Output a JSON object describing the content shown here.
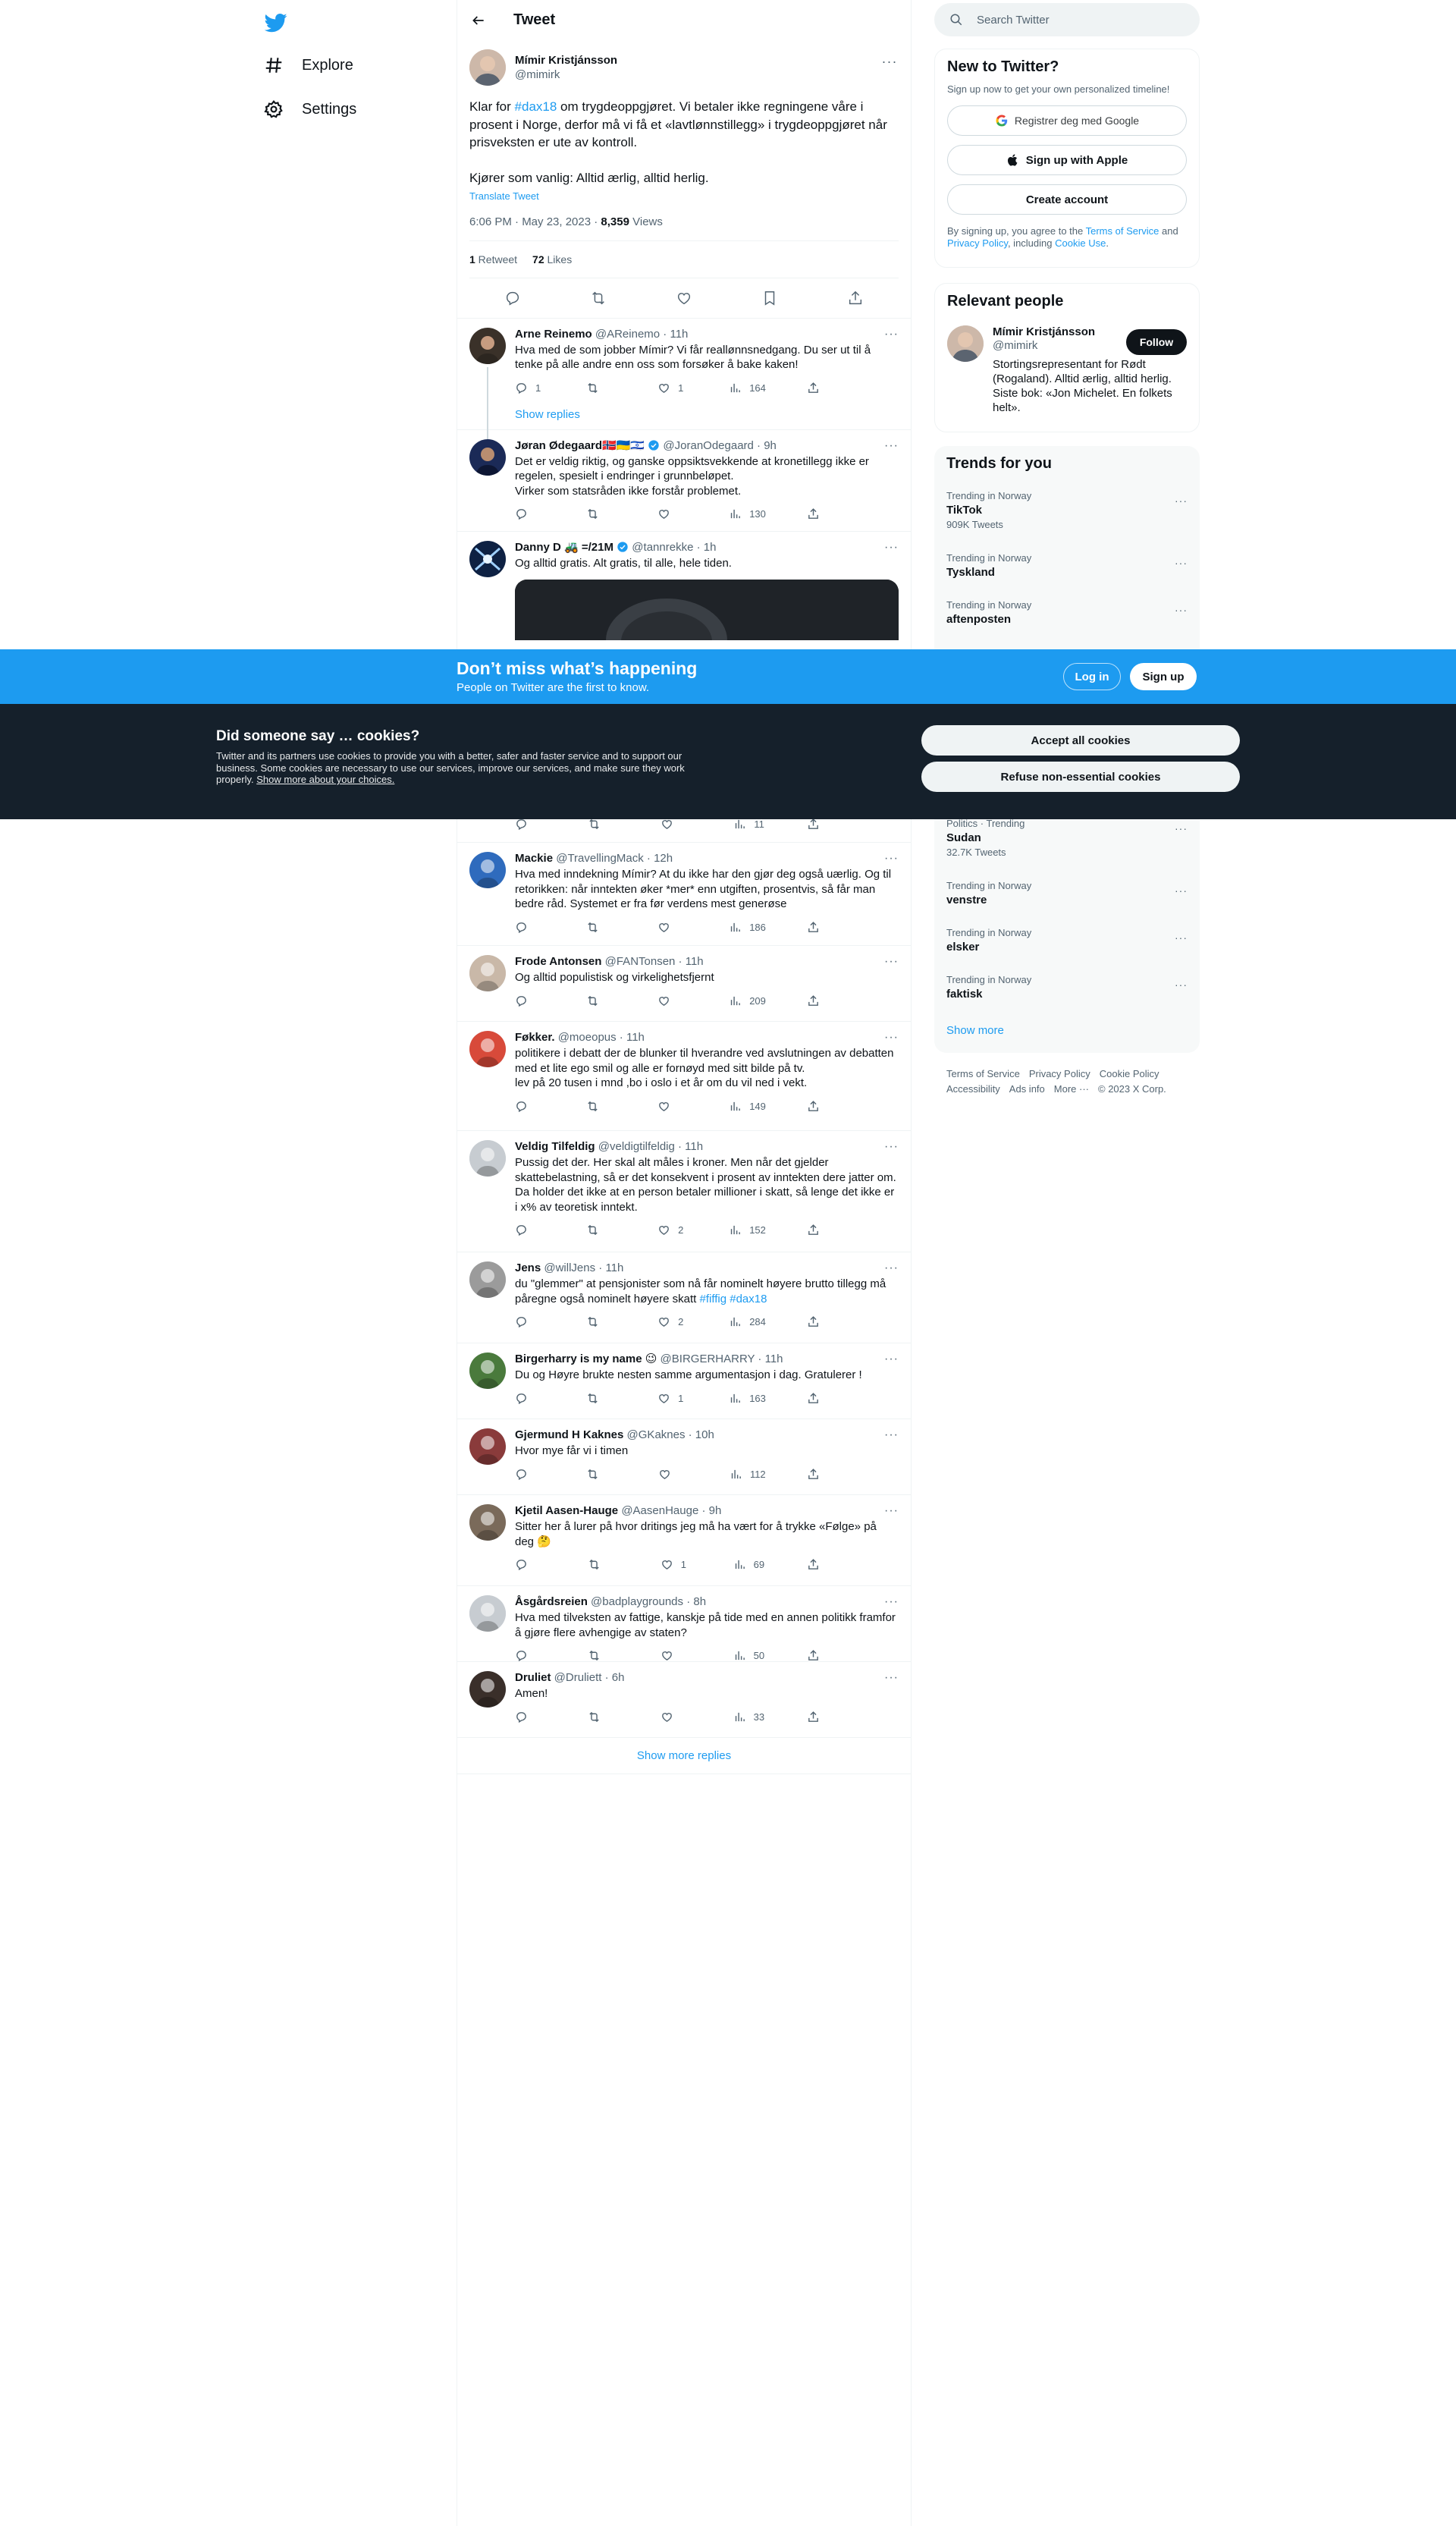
{
  "nav": {
    "explore": "Explore",
    "settings": "Settings"
  },
  "header": {
    "title": "Tweet"
  },
  "main_tweet": {
    "name": "Mímir Kristjánsson",
    "handle": "@mimirk",
    "text_before_tag": "Klar for ",
    "hashtag": "#dax18",
    "text_after_tag": " om trygdeoppgjøret. Vi betaler ikke regningene våre i prosent i Norge, derfor må vi få et «lavtlønnstillegg» i trygdeoppgjøret når prisveksten er ute av kontroll.\n\nKjører som vanlig: Alltid ærlig, alltid herlig.",
    "translate": "Translate Tweet",
    "timestamp": "6:06 PM · May 23, 2023 · ",
    "views": "8,359",
    "views_label": " Views",
    "retweets": "1",
    "retweets_label": " Retweet",
    "likes": "72",
    "likes_label": " Likes"
  },
  "replies": [
    {
      "name": "Arne Reinemo",
      "meta": " @AReinemo · 11h",
      "text": "Hva med de som jobber Mímir? Vi får reallønnsnedgang. Du ser ut til å tenke på alle andre enn oss som forsøker å bake kaken!",
      "reply": "1",
      "retweet": "",
      "like": "1",
      "views": "164",
      "show_replies": "Show replies"
    },
    {
      "name": "Jøran Ødegaard🇳🇴🇺🇦🇮🇱",
      "meta": " @JoranOdegaard · 9h",
      "text": "Det er veldig riktig, og ganske oppsiktsvekkende at kronetillegg ikke er regelen, spesielt i endringer i grunnbeløpet.\nVirker som statsråden ikke forstår problemet.",
      "reply": "",
      "retweet": "",
      "like": "",
      "views": "130"
    },
    {
      "name": "Danny D 🚜 =/21M",
      "meta": " @tannrekke · 1h",
      "text": "Og alltid gratis. Alt gratis, til alle, hele tiden."
    },
    {
      "name": "Mackie",
      "meta": " @TravellingMack · 12h",
      "text": "Hva med inndekning Mímir? At du ikke har den gjør deg også uærlig. Og til retorikken: når inntekten øker *mer* enn utgiften, prosentvis, så får man bedre råd. Systemet er fra før verdens mest generøse",
      "reply": "",
      "retweet": "",
      "like": "",
      "views": "186"
    },
    {
      "name": "Frode Antonsen",
      "meta": " @FANTonsen · 11h",
      "text": "Og alltid populistisk og virkelighetsfjernt",
      "reply": "",
      "retweet": "",
      "like": "",
      "views": "209"
    },
    {
      "name": "Føkker.",
      "meta": " @moeopus · 11h",
      "text": "politikere i debatt der de blunker til hverandre ved avslutningen av debatten med et lite ego smil og alle er fornøyd med sitt bilde på tv.\nlev på 20 tusen i mnd ,bo i oslo i et år om du vil ned i vekt.",
      "reply": "",
      "retweet": "",
      "like": "",
      "views": "149"
    },
    {
      "name": "Veldig Tilfeldig",
      "meta": " @veldigtilfeldig · 11h",
      "text": "Pussig det der. Her skal alt måles i kroner. Men når det gjelder skattebelastning, så er det konsekvent i prosent av inntekten dere jatter om. Da holder det ikke at en person betaler millioner i skatt, så lenge det ikke er i x% av teoretisk inntekt.",
      "reply": "",
      "retweet": "",
      "like": "2",
      "views": "152"
    },
    {
      "name": "Jens",
      "meta": " @willJens · 11h",
      "text": "du \"glemmer\" at pensjonister som nå får nominelt høyere brutto tillegg må påregne også nominelt høyere skatt ",
      "tags": "#fiffig #dax18",
      "reply": "",
      "retweet": "",
      "like": "2",
      "views": "284"
    },
    {
      "name": "Birgerharry is my name 😉",
      "meta": " @BIRGERHARRY · 11h",
      "text": "Du og Høyre brukte nesten samme argumentasjon i dag. Gratulerer !",
      "reply": "",
      "retweet": "",
      "like": "1",
      "views": "163"
    },
    {
      "name": "Gjermund H Kaknes",
      "meta": " @GKaknes · 10h",
      "text": "Hvor mye får vi i timen",
      "reply": "",
      "retweet": "",
      "like": "",
      "views": "112"
    },
    {
      "name": "Kjetil Aasen-Hauge",
      "meta": " @AasenHauge · 9h",
      "text": "Sitter her å lurer på hvor dritings jeg må ha vært for å trykke «Følge» på deg 🤔",
      "reply": "",
      "retweet": "",
      "like": "1",
      "views": "69"
    },
    {
      "name": "Åsgårdsreien",
      "meta": " @badplaygrounds · 8h",
      "text": "Hva med tilveksten av fattige, kanskje på tide med en annen politikk framfor å gjøre flere avhengige av staten?",
      "reply": "",
      "retweet": "",
      "like": "",
      "views": "50"
    },
    {
      "name": "Druliet",
      "meta": " @Druliett · 6h",
      "text": "Amen!",
      "reply": "",
      "retweet": "",
      "like": "",
      "views": "33"
    }
  ],
  "hidden_reply_views": "11",
  "show_more_replies": "Show more replies",
  "search": {
    "placeholder": "Search Twitter"
  },
  "new_to_twitter": {
    "title": "New to Twitter?",
    "subtitle": "Sign up now to get your own personalized timeline!",
    "google": "Registrer deg med Google",
    "apple": "Sign up with Apple",
    "create": "Create account",
    "legal_1": "By signing up, you agree to the ",
    "terms": "Terms of Service",
    "legal_2": " and ",
    "privacy": "Privacy Policy",
    "legal_3": ", including ",
    "cookie": "Cookie Use",
    "legal_4": "."
  },
  "relevant_people": {
    "title": "Relevant people",
    "name": "Mímir Kristjánsson",
    "handle": "@mimirk",
    "bio": "Stortingsrepresentant for Rødt (Rogaland). Alltid ærlig, alltid herlig. Siste bok: «Jon Michelet. En folkets helt».",
    "follow": "Follow"
  },
  "trends": {
    "title": "Trends for you",
    "items": [
      {
        "context": "Trending in Norway",
        "name": "TikTok",
        "count": "909K Tweets"
      },
      {
        "context": "Trending in Norway",
        "name": "Tyskland",
        "count": ""
      },
      {
        "context": "Trending in Norway",
        "name": "aftenposten",
        "count": ""
      },
      {
        "context": "Politics · Trending",
        "name": "Sudan",
        "count": "32.7K Tweets"
      },
      {
        "context": "Trending in Norway",
        "name": "venstre",
        "count": ""
      },
      {
        "context": "Trending in Norway",
        "name": "elsker",
        "count": ""
      },
      {
        "context": "Trending in Norway",
        "name": "faktisk",
        "count": ""
      }
    ],
    "show_more": "Show more"
  },
  "footer": {
    "terms": "Terms of Service",
    "privacy": "Privacy Policy",
    "cookie": "Cookie Policy",
    "accessibility": "Accessibility",
    "ads": "Ads info",
    "more": "More ···",
    "copyright": "© 2023 X Corp."
  },
  "banner": {
    "title": "Don’t miss what’s happening",
    "subtitle": "People on Twitter are the first to know.",
    "login": "Log in",
    "signup": "Sign up"
  },
  "cookies": {
    "title": "Did someone say … cookies?",
    "text": "Twitter and its partners use cookies to provide you with a better, safer and faster service and to support our business. Some cookies are necessary to use our services, improve our services, and make sure they work properly. ",
    "link": "Show more about your choices.",
    "accept": "Accept all cookies",
    "refuse": "Refuse non-essential cookies"
  },
  "colors": {
    "accent": "#1d9bf0",
    "text": "#0f1419",
    "muted": "#536471",
    "cookie_bg": "#15202b"
  }
}
